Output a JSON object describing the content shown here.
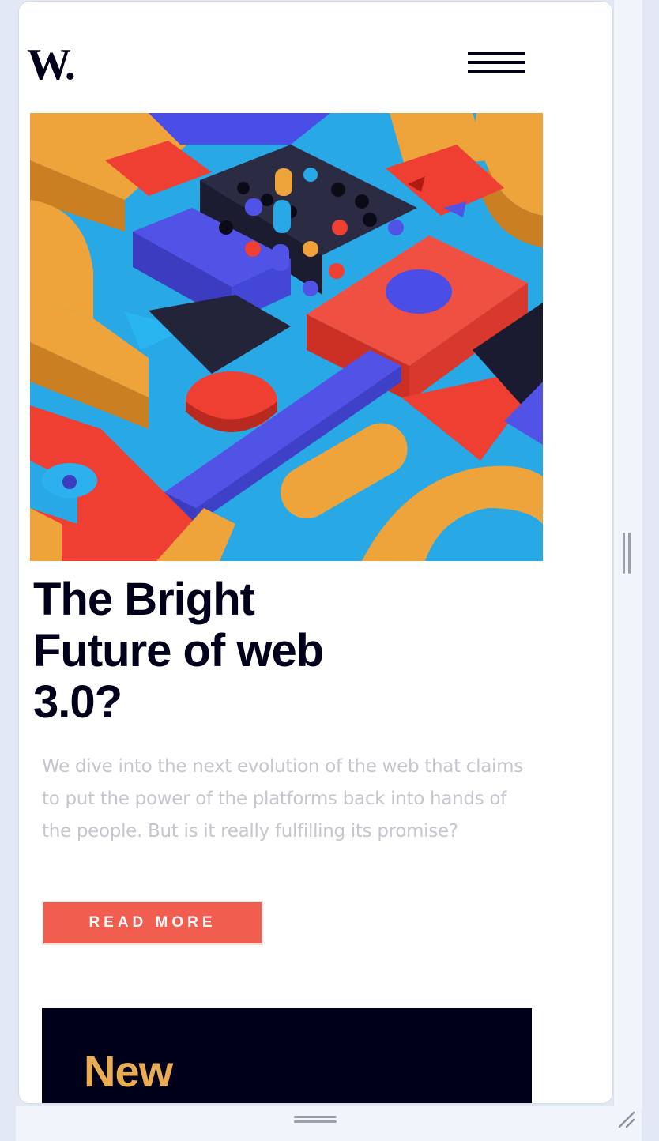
{
  "header": {
    "logo_text": "W.",
    "menu_icon": "hamburger-menu-icon"
  },
  "hero": {
    "image_description_icon": "abstract-3d-blocks-image",
    "headline": "The Bright Future of web 3.0?",
    "description": "We dive into the next evolution of the web that claims to put the power of the platforms back into hands of the people. But is it really fulfilling its promise?",
    "cta_label": "READ MORE"
  },
  "new_section": {
    "title": "New"
  },
  "colors": {
    "navy": "#00001a",
    "accent_red": "#f15e50",
    "accent_orange": "#e9ab53",
    "muted_text": "#c5c6ce",
    "background": "#ffffff"
  },
  "viewport_controls": {
    "vertical_handle_icon": "vertical-resize-handle-icon",
    "horizontal_handle_icon": "horizontal-resize-handle-icon",
    "corner_handle_icon": "corner-resize-icon"
  }
}
